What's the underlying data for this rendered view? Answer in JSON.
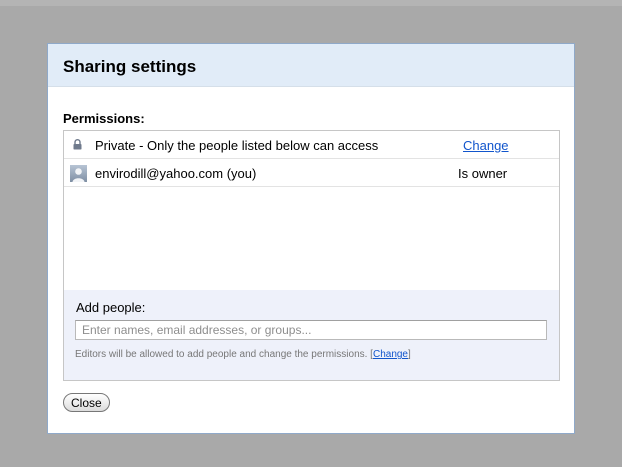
{
  "dialog": {
    "title": "Sharing settings"
  },
  "permissions": {
    "label": "Permissions:",
    "visibility": {
      "icon": "lock-icon",
      "text": "Private - Only the people listed below can access",
      "change_label": "Change"
    },
    "people": [
      {
        "icon": "avatar-icon",
        "email": "envirodill@yahoo.com (you)",
        "role": "Is owner"
      }
    ]
  },
  "add_people": {
    "label": "Add people:",
    "placeholder": "Enter names, email addresses, or groups...",
    "editors_note_prefix": "Editors will be allowed to add people and change the permissions. [",
    "editors_note_link": "Change",
    "editors_note_suffix": "]"
  },
  "buttons": {
    "close_label": "Close"
  },
  "colors": {
    "overlay": "#a9a9a9",
    "header_background": "#e1ecf8",
    "dialog_border": "#8fa9c9",
    "add_section_background": "#eef1fa",
    "link": "#1155cc"
  }
}
